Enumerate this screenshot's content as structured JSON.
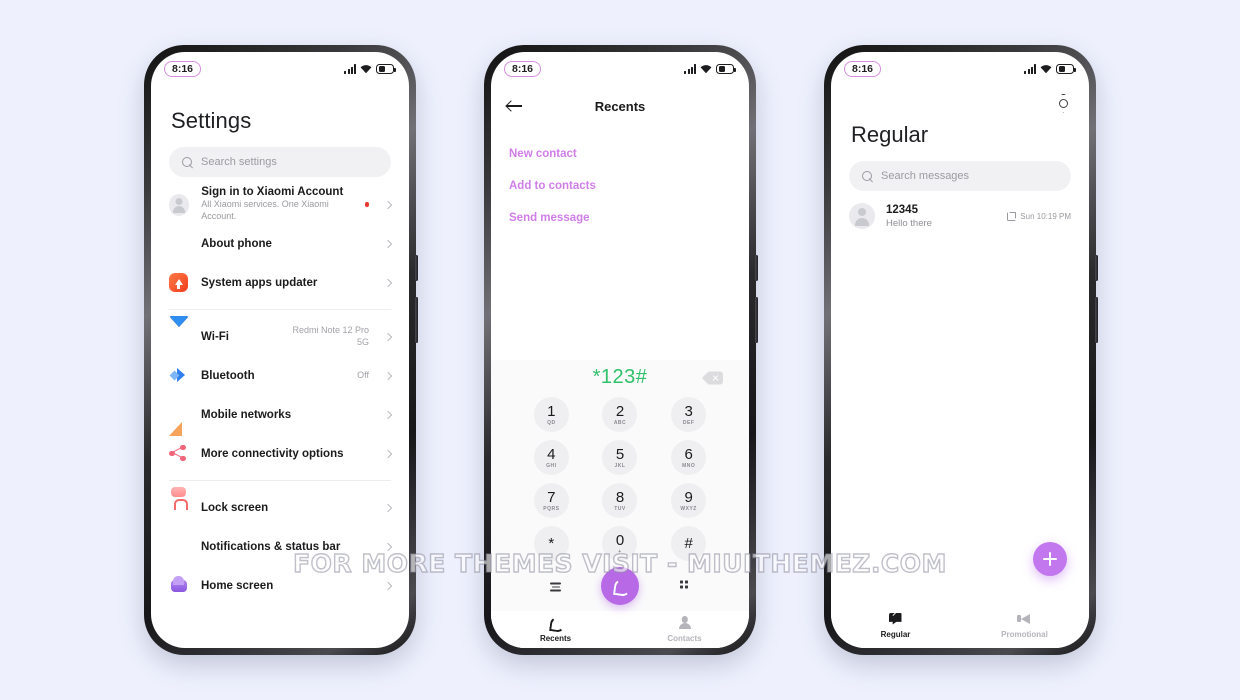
{
  "background_color": "#eef1fd",
  "watermark": "FOR MORE THEMES VISIT - MIUITHEMEZ.COM",
  "status_bar": {
    "time": "8:16",
    "signal_icon": "signal-bars-icon",
    "wifi_icon": "wifi-icon",
    "battery_icon": "battery-icon"
  },
  "accent_colors": {
    "purple": "#c277ee",
    "link_purple": "#cf7ee8",
    "green": "#2fc06a",
    "red_badge": "#e8382f"
  },
  "settings_screen": {
    "title": "Settings",
    "search_placeholder": "Search settings",
    "account": {
      "title": "Sign in to Xiaomi Account",
      "subtitle": "All Xiaomi services. One Xiaomi Account.",
      "has_badge": true
    },
    "group1": [
      {
        "label": "About phone",
        "value": "",
        "icon": "about-phone-icon"
      },
      {
        "label": "System apps updater",
        "value": "",
        "icon": "system-updater-icon"
      }
    ],
    "group2": [
      {
        "label": "Wi-Fi",
        "value": "Redmi Note 12 Pro 5G",
        "icon": "wifi-icon"
      },
      {
        "label": "Bluetooth",
        "value": "Off",
        "icon": "bluetooth-icon"
      },
      {
        "label": "Mobile networks",
        "value": "",
        "icon": "mobile-networks-icon"
      },
      {
        "label": "More connectivity options",
        "value": "",
        "icon": "share-icon"
      }
    ],
    "group3": [
      {
        "label": "Lock screen",
        "value": "",
        "icon": "lock-icon"
      },
      {
        "label": "Notifications & status bar",
        "value": "",
        "icon": "notifications-icon"
      },
      {
        "label": "Home screen",
        "value": "",
        "icon": "home-screen-icon"
      }
    ]
  },
  "dialer_screen": {
    "nav_title": "Recents",
    "back_icon": "back-arrow-icon",
    "links": [
      "New contact",
      "Add to contacts",
      "Send message"
    ],
    "dialed_number": "*123#",
    "backspace_icon": "backspace-icon",
    "keys": [
      {
        "digit": "1",
        "letters": "QD"
      },
      {
        "digit": "2",
        "letters": "ABC"
      },
      {
        "digit": "3",
        "letters": "DEF"
      },
      {
        "digit": "4",
        "letters": "GHI"
      },
      {
        "digit": "5",
        "letters": "JKL"
      },
      {
        "digit": "6",
        "letters": "MNO"
      },
      {
        "digit": "7",
        "letters": "PQRS"
      },
      {
        "digit": "8",
        "letters": "TUV"
      },
      {
        "digit": "9",
        "letters": "WXYZ"
      },
      {
        "digit": "*",
        "letters": ""
      },
      {
        "digit": "0",
        "letters": "+"
      },
      {
        "digit": "#",
        "letters": ""
      }
    ],
    "call_button_icon": "call-handset-icon",
    "bottom_nav": [
      {
        "label": "Recents",
        "icon": "phone-icon",
        "active": true
      },
      {
        "label": "Contacts",
        "icon": "person-icon",
        "active": false
      }
    ]
  },
  "messages_screen": {
    "settings_icon": "gear-icon",
    "title": "Regular",
    "search_placeholder": "Search messages",
    "conversations": [
      {
        "name": "12345",
        "preview": "Hello there",
        "time": "Sun 10:19 PM",
        "sim_icon": "sim-icon"
      }
    ],
    "fab_icon": "plus-icon",
    "bottom_nav": [
      {
        "label": "Regular",
        "icon": "message-icon",
        "active": true
      },
      {
        "label": "Promotional",
        "icon": "megaphone-icon",
        "active": false
      }
    ]
  }
}
